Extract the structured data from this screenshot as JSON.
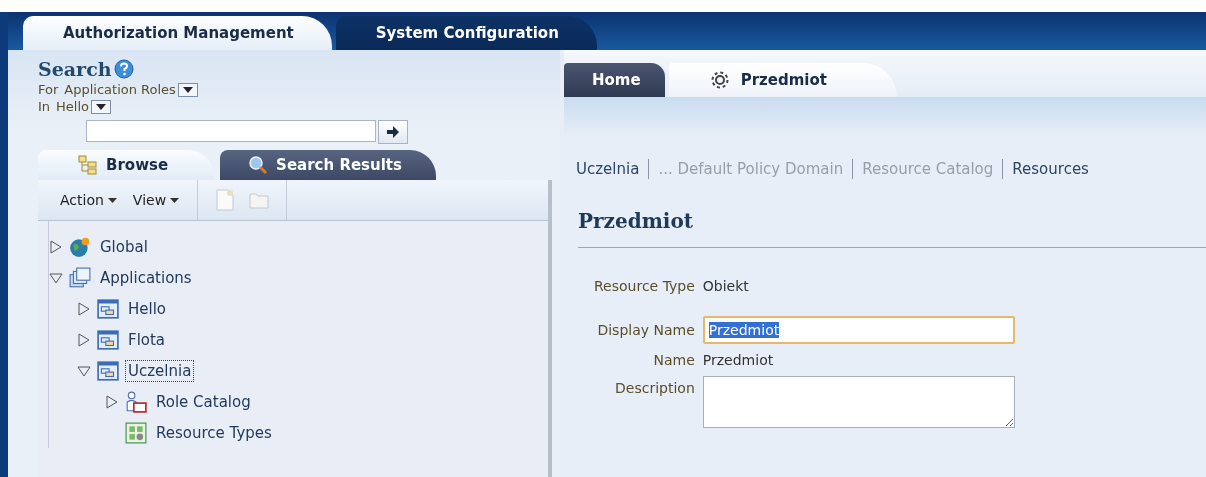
{
  "top_tabs": [
    {
      "label": "Authorization Management",
      "selected": true
    },
    {
      "label": "System Configuration",
      "selected": false
    }
  ],
  "search": {
    "title": "Search",
    "for_label": "For",
    "for_value": "Application Roles",
    "in_label": "In",
    "in_value": "Hello"
  },
  "browse_tabs": [
    {
      "label": "Browse",
      "kind": "browse",
      "selected": true
    },
    {
      "label": "Search Results",
      "kind": "search",
      "selected": false
    }
  ],
  "toolbar": {
    "menus": [
      "Action",
      "View"
    ]
  },
  "tree": [
    {
      "label": "Global",
      "kind": "globe",
      "expanded": false,
      "selected": false
    },
    {
      "label": "Applications",
      "kind": "applications",
      "expanded": true,
      "selected": false,
      "children": [
        {
          "label": "Hello",
          "kind": "application",
          "expanded": false,
          "selected": false
        },
        {
          "label": "Flota",
          "kind": "application",
          "expanded": false,
          "selected": false
        },
        {
          "label": "Uczelnia",
          "kind": "application",
          "expanded": true,
          "selected": true,
          "children": [
            {
              "label": "Role Catalog",
              "kind": "role-catalog",
              "expanded": false,
              "selected": false
            },
            {
              "label": "Resource Types",
              "kind": "resource-types",
              "selected": false
            }
          ]
        }
      ]
    }
  ],
  "content_tabs": [
    {
      "label": "Home",
      "kind": "plain",
      "selected": false
    },
    {
      "label": "Przedmiot",
      "kind": "gear",
      "selected": true
    }
  ],
  "breadcrumbs": [
    {
      "label": "Uczelnia",
      "disabled": false
    },
    {
      "label": "... Default Policy Domain",
      "disabled": true
    },
    {
      "label": "Resource Catalog",
      "disabled": true
    },
    {
      "label": "Resources",
      "disabled": false
    }
  ],
  "heading": "Przedmiot",
  "form": [
    {
      "label": "Resource Type",
      "kind": "text",
      "value": "Obiekt"
    },
    {
      "label": "Display Name",
      "kind": "input",
      "value": "Przedmiot"
    },
    {
      "label": "Name",
      "kind": "text",
      "value": "Przedmiot"
    },
    {
      "label": "Description",
      "kind": "textarea"
    }
  ]
}
